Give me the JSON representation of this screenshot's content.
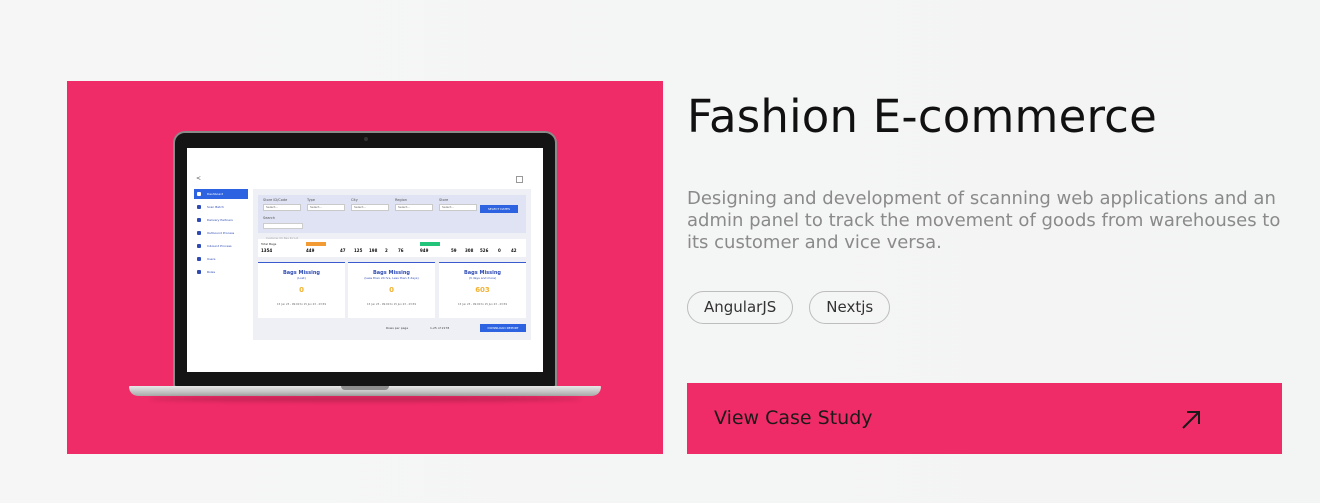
{
  "project": {
    "title": "Fashion E-commerce",
    "description": "Designing and development of scanning web applications and an admin panel to track the movement of goods from warehouses to its customer and vice versa.",
    "tags": [
      "AngularJS",
      "Nextjs"
    ],
    "cta_label": "View Case Study",
    "accent": "#f02c68"
  },
  "mockup": {
    "back": "<",
    "sidebar": [
      "Dashboard",
      "Scan Batch",
      "Delivery Partners",
      "Outbound Process",
      "Inbound Process",
      "Users",
      "Roles"
    ],
    "filters": [
      {
        "label": "Store ID/Code",
        "value": "Select..."
      },
      {
        "label": "Type",
        "value": "Select..."
      },
      {
        "label": "City",
        "value": "Select..."
      },
      {
        "label": "Region",
        "value": "Select..."
      },
      {
        "label": "Store",
        "value": "Select..."
      }
    ],
    "filter_button": "SELECT DATES",
    "search_label": "Search",
    "search_placeholder": "Customer ID/ Bag ID/ Lot",
    "stats": [
      {
        "label": "Total Bags",
        "value": "1354"
      },
      {
        "label": "",
        "value": "449"
      },
      {
        "label": "",
        "value": "47"
      },
      {
        "label": "",
        "value": "125"
      },
      {
        "label": "",
        "value": "198"
      },
      {
        "label": "",
        "value": "2"
      },
      {
        "label": "",
        "value": "76"
      },
      {
        "label": "",
        "value": "949"
      },
      {
        "label": "",
        "value": "59"
      },
      {
        "label": "",
        "value": "308"
      },
      {
        "label": "",
        "value": "526"
      },
      {
        "label": "",
        "value": "0"
      },
      {
        "label": "",
        "value": "42"
      }
    ],
    "cards": [
      {
        "title": "Bags Missing",
        "sub": "(Lost)",
        "value": "0",
        "dates": "15 Jun 23 - 09:00 to 15 Jun 23 - 23:59"
      },
      {
        "title": "Bags Missing",
        "sub": "(Less than 24 hrs, Less than 3 days)",
        "value": "0",
        "dates": "15 Jun 23 - 09:00 to 15 Jun 23 - 23:59"
      },
      {
        "title": "Bags Missing",
        "sub": "(3 days and more)",
        "value": "603",
        "dates": "15 Jun 23 - 09:00 to 15 Jun 23 - 23:59"
      }
    ],
    "pager_rows": "Rows per page",
    "pager_count": "1-25 of 2178",
    "pager_button": "DOWNLOAD REPORT"
  }
}
